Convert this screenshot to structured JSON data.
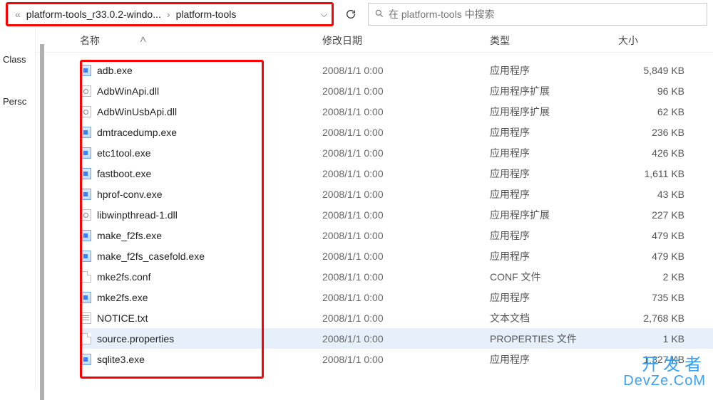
{
  "addressbar": {
    "prefix": "«",
    "crumb1": "platform-tools_r33.0.2-windo...",
    "crumb2": "platform-tools"
  },
  "search": {
    "placeholder": "在 platform-tools 中搜索"
  },
  "nav": {
    "item1": "Class",
    "item2": "Persc"
  },
  "headers": {
    "name": "名称",
    "date": "修改日期",
    "type": "类型",
    "size": "大小"
  },
  "files": [
    {
      "icon": "exe",
      "name": "adb.exe",
      "date": "2008/1/1 0:00",
      "type": "应用程序",
      "size": "5,849 KB"
    },
    {
      "icon": "dll",
      "name": "AdbWinApi.dll",
      "date": "2008/1/1 0:00",
      "type": "应用程序扩展",
      "size": "96 KB"
    },
    {
      "icon": "dll",
      "name": "AdbWinUsbApi.dll",
      "date": "2008/1/1 0:00",
      "type": "应用程序扩展",
      "size": "62 KB"
    },
    {
      "icon": "exe",
      "name": "dmtracedump.exe",
      "date": "2008/1/1 0:00",
      "type": "应用程序",
      "size": "236 KB"
    },
    {
      "icon": "exe",
      "name": "etc1tool.exe",
      "date": "2008/1/1 0:00",
      "type": "应用程序",
      "size": "426 KB"
    },
    {
      "icon": "exe",
      "name": "fastboot.exe",
      "date": "2008/1/1 0:00",
      "type": "应用程序",
      "size": "1,611 KB"
    },
    {
      "icon": "exe",
      "name": "hprof-conv.exe",
      "date": "2008/1/1 0:00",
      "type": "应用程序",
      "size": "43 KB"
    },
    {
      "icon": "dll",
      "name": "libwinpthread-1.dll",
      "date": "2008/1/1 0:00",
      "type": "应用程序扩展",
      "size": "227 KB"
    },
    {
      "icon": "exe",
      "name": "make_f2fs.exe",
      "date": "2008/1/1 0:00",
      "type": "应用程序",
      "size": "479 KB"
    },
    {
      "icon": "exe",
      "name": "make_f2fs_casefold.exe",
      "date": "2008/1/1 0:00",
      "type": "应用程序",
      "size": "479 KB"
    },
    {
      "icon": "generic",
      "name": "mke2fs.conf",
      "date": "2008/1/1 0:00",
      "type": "CONF 文件",
      "size": "2 KB"
    },
    {
      "icon": "exe",
      "name": "mke2fs.exe",
      "date": "2008/1/1 0:00",
      "type": "应用程序",
      "size": "735 KB"
    },
    {
      "icon": "txt",
      "name": "NOTICE.txt",
      "date": "2008/1/1 0:00",
      "type": "文本文档",
      "size": "2,768 KB"
    },
    {
      "icon": "generic",
      "name": "source.properties",
      "date": "2008/1/1 0:00",
      "type": "PROPERTIES 文件",
      "size": "1 KB",
      "selected": true
    },
    {
      "icon": "exe",
      "name": "sqlite3.exe",
      "date": "2008/1/1 0:00",
      "type": "应用程序",
      "size": "1,327 KB"
    }
  ],
  "watermark": {
    "cn": "开发者",
    "en": "DevZe.CoM"
  }
}
